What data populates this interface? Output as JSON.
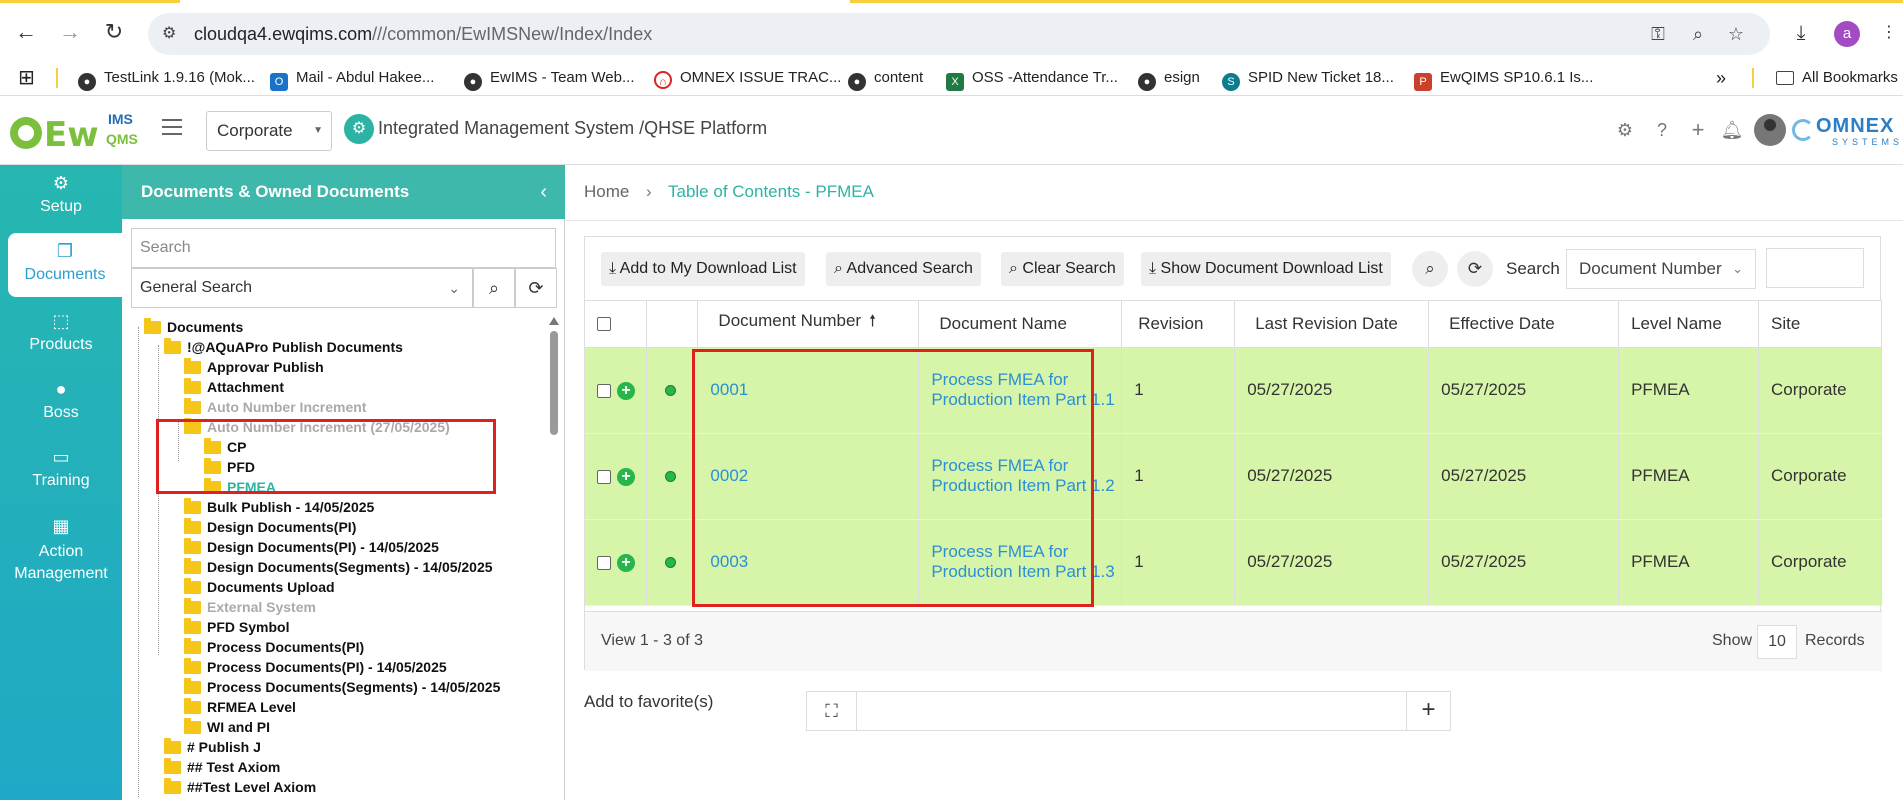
{
  "browser": {
    "url_host": "cloudqa4.ewqims.com",
    "url_path": "///common/EwIMSNew/Index/Index",
    "profile_initial": "a",
    "bookmarks": [
      {
        "label": "TestLink 1.9.16 (Mok...",
        "icon": "globe-icon"
      },
      {
        "label": "Mail - Abdul Hakee...",
        "icon": "outlook-icon"
      },
      {
        "label": "EwIMS - Team Web...",
        "icon": "globe-icon"
      },
      {
        "label": "OMNEX ISSUE TRAC...",
        "icon": "arc-icon"
      },
      {
        "label": "content",
        "icon": "globe-icon"
      },
      {
        "label": "OSS -Attendance Tr...",
        "icon": "excel-icon"
      },
      {
        "label": "esign",
        "icon": "globe-icon"
      },
      {
        "label": "SPID New Ticket 18...",
        "icon": "sharepoint-icon"
      },
      {
        "label": "EwQIMS SP10.6.1 Is...",
        "icon": "powerpoint-icon"
      }
    ],
    "all_bookmarks": "All Bookmarks"
  },
  "header": {
    "site_select": "Corporate",
    "title": "Integrated Management System /QHSE Platform",
    "logo_ew": "Ew",
    "logo_ims": "IMS",
    "logo_qms": "QMS",
    "omnex_name": "OMNEX",
    "omnex_sub": "SYSTEMS"
  },
  "leftnav": [
    {
      "label": "Setup",
      "icon": "gears-icon"
    },
    {
      "label": "Documents",
      "icon": "documents-icon"
    },
    {
      "label": "Products",
      "icon": "products-icon"
    },
    {
      "label": "Boss",
      "icon": "user-icon"
    },
    {
      "label": "Training",
      "icon": "training-icon"
    },
    {
      "label": "Action Management",
      "icon": "building-icon"
    }
  ],
  "tree_panel": {
    "title": "Documents & Owned Documents",
    "search_placeholder": "Search",
    "search_type": "General Search",
    "items": [
      {
        "label": "Documents"
      },
      {
        "label": "!@AQuAPro Publish Documents"
      },
      {
        "label": "Approvar Publish"
      },
      {
        "label": "Attachment"
      },
      {
        "label": "Auto Number Increment"
      },
      {
        "label": "Auto Number Increment (27/05/2025)"
      },
      {
        "label": "CP"
      },
      {
        "label": "PFD"
      },
      {
        "label": "PFMEA"
      },
      {
        "label": "Bulk Publish - 14/05/2025"
      },
      {
        "label": "Design Documents(PI)"
      },
      {
        "label": "Design Documents(PI) - 14/05/2025"
      },
      {
        "label": "Design Documents(Segments) - 14/05/2025"
      },
      {
        "label": "Documents Upload"
      },
      {
        "label": "External System"
      },
      {
        "label": "PFD Symbol"
      },
      {
        "label": "Process Documents(PI)"
      },
      {
        "label": "Process Documents(PI) - 14/05/2025"
      },
      {
        "label": "Process Documents(Segments) - 14/05/2025"
      },
      {
        "label": "RFMEA Level"
      },
      {
        "label": "WI and PI"
      },
      {
        "label": "# Publish J"
      },
      {
        "label": "## Test Axiom"
      },
      {
        "label": "##Test Level Axiom"
      }
    ]
  },
  "breadcrumb": {
    "home": "Home",
    "separator": "›",
    "current": "Table of Contents - PFMEA"
  },
  "toolbar": {
    "add_download": "Add to My Download List",
    "advanced_search": "Advanced Search",
    "clear_search": "Clear Search",
    "show_download": "Show Document Download List",
    "search_label": "Search",
    "search_field": "Document Number"
  },
  "grid": {
    "columns": [
      "Document Number",
      "Document Name",
      "Revision",
      "Last Revision Date",
      "Effective Date",
      "Level Name",
      "Site"
    ],
    "rows": [
      {
        "number": "0001",
        "name": "Process FMEA for Production Item Part 1.1",
        "revision": "1",
        "last_rev": "05/27/2025",
        "effective": "05/27/2025",
        "level": "PFMEA",
        "site": "Corporate"
      },
      {
        "number": "0002",
        "name": "Process FMEA for Production Item Part 1.2",
        "revision": "1",
        "last_rev": "05/27/2025",
        "effective": "05/27/2025",
        "level": "PFMEA",
        "site": "Corporate"
      },
      {
        "number": "0003",
        "name": "Process FMEA for Production Item Part 1.3",
        "revision": "1",
        "last_rev": "05/27/2025",
        "effective": "05/27/2025",
        "level": "PFMEA",
        "site": "Corporate"
      }
    ],
    "footer_view": "View 1 - 3 of 3",
    "footer_show": "Show",
    "footer_count": "10",
    "footer_records": "Records"
  },
  "favorites": {
    "label": "Add to favorite(s)"
  },
  "colors": {
    "teal": "#3fb8ac",
    "row_green": "#d6f5a8",
    "link_blue": "#2b8fd6",
    "highlight_red": "#e0201f"
  }
}
